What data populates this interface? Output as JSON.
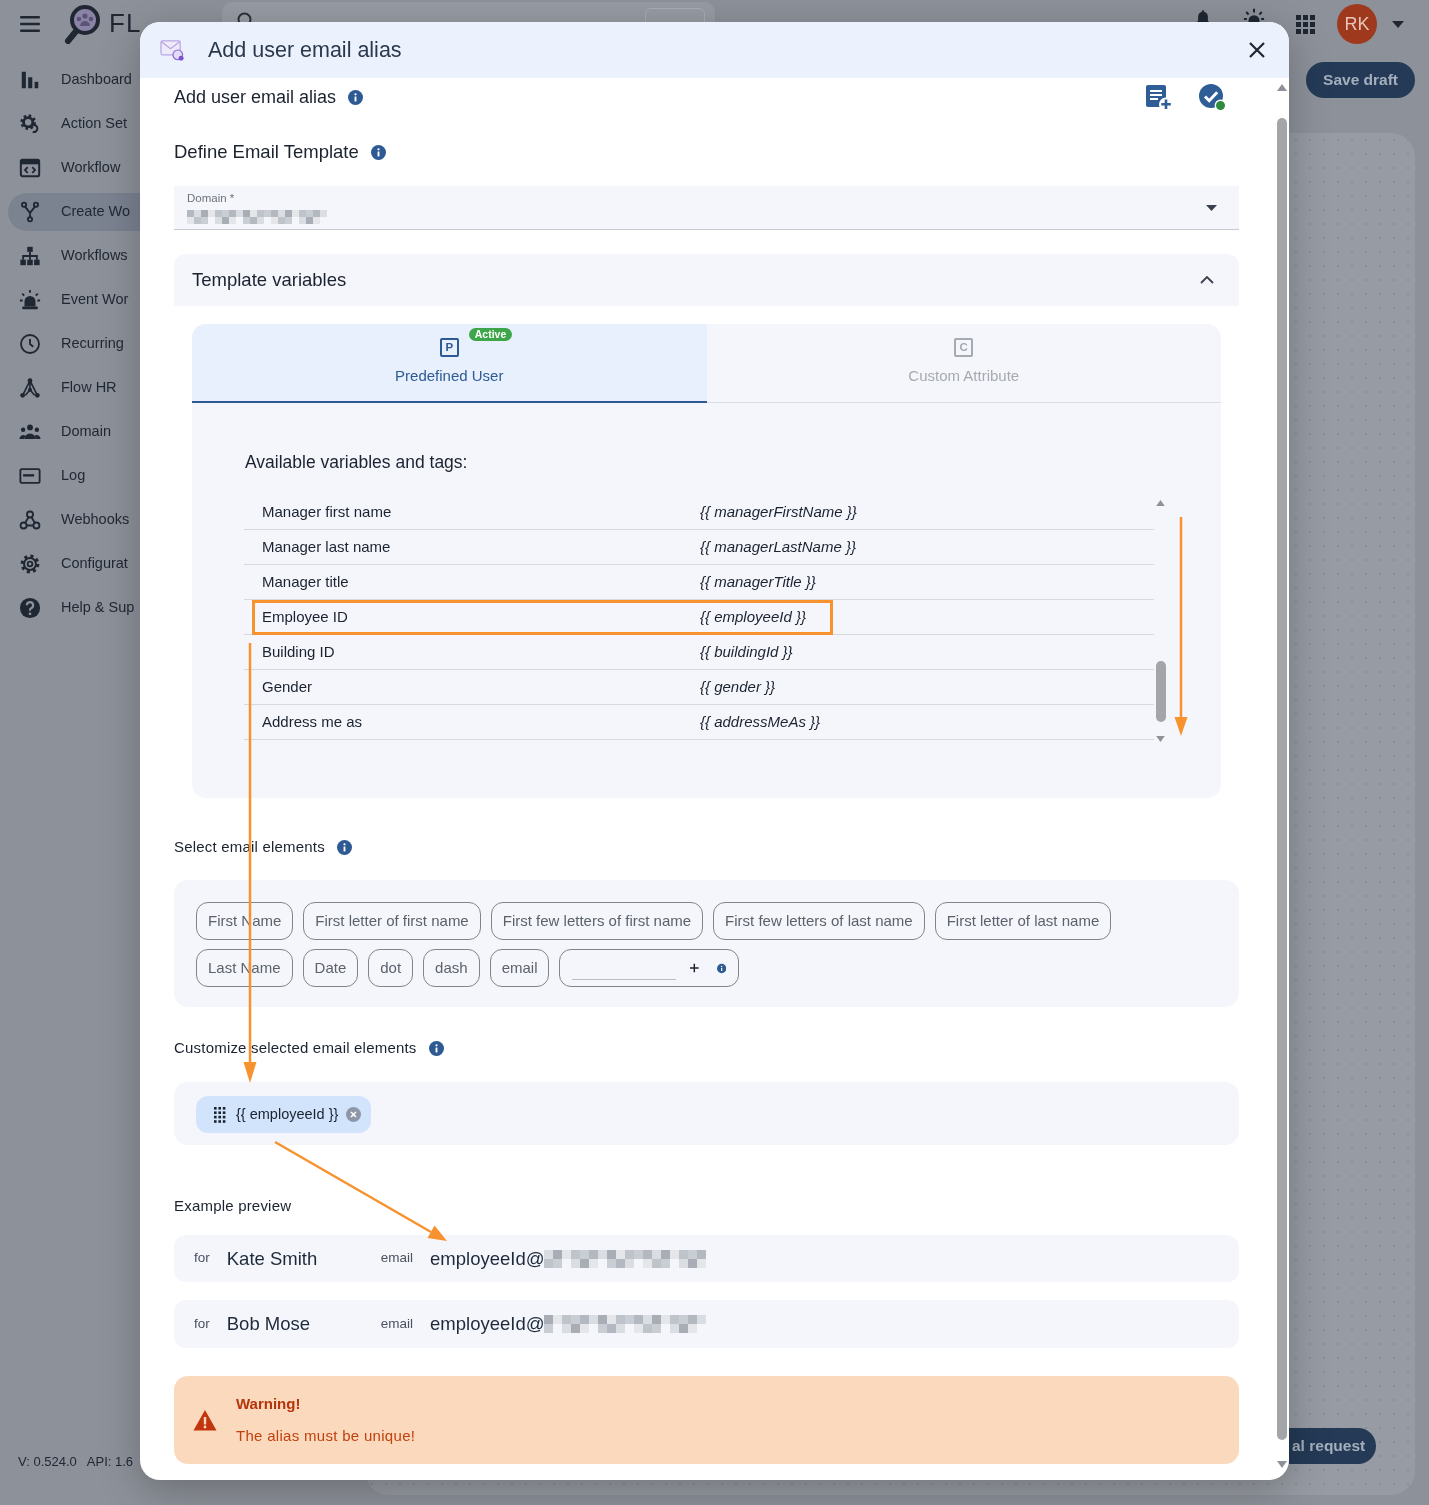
{
  "app_header": {
    "logo": "FL",
    "avatar": "RK"
  },
  "sidebar": {
    "items": [
      {
        "label": "Dashboard",
        "selected": false
      },
      {
        "label": "Action Set",
        "selected": false
      },
      {
        "label": "Workflow",
        "selected": false
      },
      {
        "label": "Create Wo",
        "selected": true
      },
      {
        "label": "Workflows",
        "selected": false
      },
      {
        "label": "Event Wor",
        "selected": false
      },
      {
        "label": "Recurring",
        "selected": false
      },
      {
        "label": "Flow HR",
        "selected": false
      },
      {
        "label": "Domain",
        "selected": false
      },
      {
        "label": "Log",
        "selected": false
      },
      {
        "label": "Webhooks",
        "selected": false
      },
      {
        "label": "Configurat",
        "selected": false
      },
      {
        "label": "Help & Sup",
        "selected": false
      }
    ],
    "version": "V: 0.524.0",
    "api": "API: 1.6"
  },
  "page": {
    "save_button": "Save draft",
    "request_button": "al request"
  },
  "modal": {
    "title": "Add user email alias",
    "heading": "Add user email alias",
    "section_title": "Define Email Template",
    "domain_field": {
      "label": "Domain *"
    },
    "accordion": {
      "title": "Template variables",
      "expanded": true,
      "tabs": [
        {
          "glyph": "P",
          "label": "Predefined User",
          "badge": "Active",
          "selected": true
        },
        {
          "glyph": "C",
          "label": "Custom Attribute",
          "selected": false
        }
      ],
      "variables_title": "Available variables and tags:",
      "variables": [
        {
          "name": "Manager first name",
          "tag": "{{ managerFirstName }}",
          "highlighted": false
        },
        {
          "name": "Manager last name",
          "tag": "{{ managerLastName }}",
          "highlighted": false
        },
        {
          "name": "Manager title",
          "tag": "{{ managerTitle }}",
          "highlighted": false
        },
        {
          "name": "Employee ID",
          "tag": "{{ employeeId }}",
          "highlighted": true
        },
        {
          "name": "Building ID",
          "tag": "{{ buildingId }}",
          "highlighted": false
        },
        {
          "name": "Gender",
          "tag": "{{ gender }}",
          "highlighted": false
        },
        {
          "name": "Address me as",
          "tag": "{{ addressMeAs }}",
          "highlighted": false
        }
      ]
    },
    "email_elements": {
      "title": "Select email elements",
      "chips": [
        "First Name",
        "First letter of first name",
        "First few letters of first name",
        "First few letters of last name",
        "First letter of last name",
        "Last Name",
        "Date",
        "dot",
        "dash",
        "email"
      ]
    },
    "selected_elements": {
      "title": "Customize selected email elements",
      "chips": [
        "{{ employeeId }}"
      ]
    },
    "preview": {
      "title": "Example preview",
      "rows": [
        {
          "for_label": "for",
          "name": "Kate Smith",
          "email_label": "email",
          "email": "employeeId@"
        },
        {
          "for_label": "for",
          "name": "Bob Mose",
          "email_label": "email",
          "email": "employeeId@"
        }
      ]
    },
    "warning": {
      "title": "Warning!",
      "message": "The alias must be unique!"
    }
  },
  "annotations": [
    {
      "kind": "arrow"
    },
    {
      "kind": "arrow"
    },
    {
      "kind": "arrow"
    }
  ]
}
